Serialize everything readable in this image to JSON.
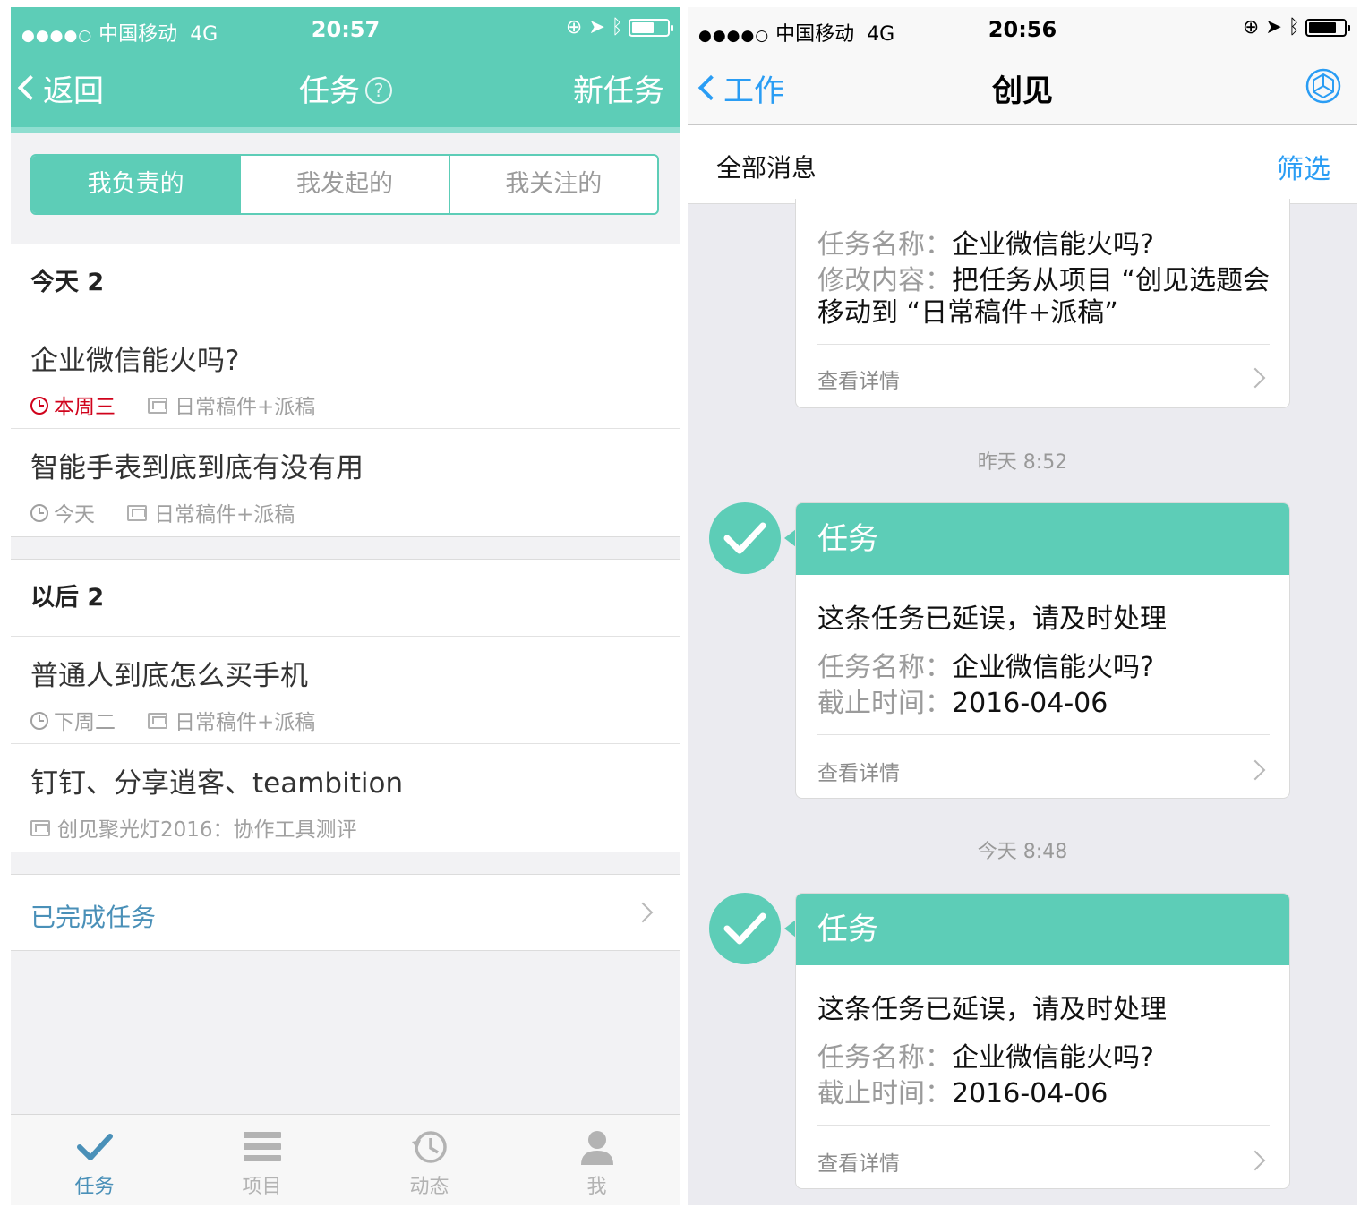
{
  "left": {
    "status_bar": {
      "carrier": "中国移动",
      "network": "4G",
      "time": "20:57"
    },
    "nav": {
      "back_label": "返回",
      "title": "任务",
      "help_icon": "?",
      "new_label": "新任务"
    },
    "segments": [
      "我负责的",
      "我发起的",
      "我关注的"
    ],
    "sections": [
      {
        "header": "今天 2",
        "tasks": [
          {
            "title": "企业微信能火吗?",
            "due": "本周三",
            "project": "日常稿件+派稿",
            "overdue": true
          },
          {
            "title": "智能手表到底到底有没有用",
            "due": "今天",
            "project": "日常稿件+派稿",
            "overdue": false
          }
        ]
      },
      {
        "header": "以后 2",
        "tasks": [
          {
            "title": "普通人到底怎么买手机",
            "due": "下周二",
            "project": "日常稿件+派稿",
            "overdue": false
          },
          {
            "title": "钉钉、分享逍客、teambition",
            "due": "",
            "project": "创见聚光灯2016：协作工具测评",
            "overdue": false
          }
        ]
      }
    ],
    "completed_label": "已完成任务",
    "tabs": [
      {
        "label": "任务",
        "icon": "checkmark-icon",
        "active": true
      },
      {
        "label": "项目",
        "icon": "list-icon",
        "active": false
      },
      {
        "label": "动态",
        "icon": "history-icon",
        "active": false
      },
      {
        "label": "我",
        "icon": "person-icon",
        "active": false
      }
    ],
    "colors": {
      "accent": "#5dcdb7",
      "link": "#4a90b8",
      "overdue": "#d0021b"
    }
  },
  "right": {
    "status_bar": {
      "carrier": "中国移动",
      "network": "4G",
      "time": "20:56"
    },
    "nav": {
      "back_label": "工作",
      "title": "创见",
      "settings_icon": "gear-icon"
    },
    "filter_bar": {
      "all_label": "全部消息",
      "filter_label": "筛选"
    },
    "partial_card": {
      "task_name_key": "任务名称：",
      "task_name": "企业微信能火吗?",
      "change_key": "修改内容：",
      "change_line1": "把任务从项目 “创见选题会",
      "change_line2": "移动到 “日常稿件+派稿”",
      "more": "查看详情"
    },
    "messages": [
      {
        "timestamp": "昨天 8:52",
        "header": "任务",
        "text": "这条任务已延误，请及时处理",
        "task_name_key": "任务名称：",
        "task_name": "企业微信能火吗?",
        "deadline_key": "截止时间：",
        "deadline": "2016-04-06",
        "more": "查看详情"
      },
      {
        "timestamp": "今天 8:48",
        "header": "任务",
        "text": "这条任务已延误，请及时处理",
        "task_name_key": "任务名称：",
        "task_name": "企业微信能火吗?",
        "deadline_key": "截止时间：",
        "deadline": "2016-04-06",
        "more": "查看详情"
      }
    ],
    "colors": {
      "accent": "#5dcdb7",
      "link": "#2a9df4"
    }
  }
}
